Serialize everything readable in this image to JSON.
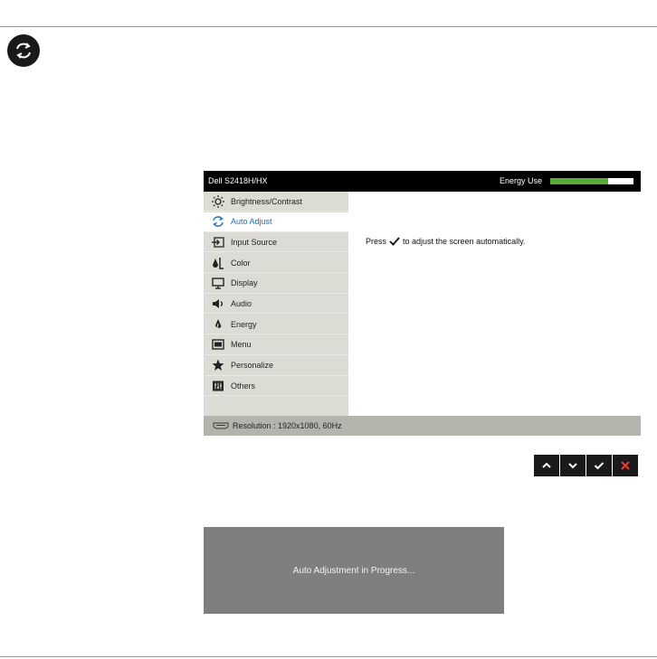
{
  "section_icon": "auto-adjust-icon",
  "osd": {
    "model": "Dell S2418H/HX",
    "energy_label": "Energy Use",
    "energy_level": 0.7,
    "colors": {
      "energy": "#5aaa3a",
      "selected_text": "#1a6fb5",
      "menu_bg": "#dcdcd4",
      "footer_bg": "#b4b4ac"
    },
    "menu": [
      {
        "label": "Brightness/Contrast",
        "icon": "brightness-icon"
      },
      {
        "label": "Auto Adjust",
        "icon": "auto-adjust-icon",
        "selected": true
      },
      {
        "label": "Input Source",
        "icon": "input-source-icon"
      },
      {
        "label": "Color",
        "icon": "color-icon"
      },
      {
        "label": "Display",
        "icon": "display-icon"
      },
      {
        "label": "Audio",
        "icon": "audio-icon"
      },
      {
        "label": "Energy",
        "icon": "energy-icon"
      },
      {
        "label": "Menu",
        "icon": "menu-icon"
      },
      {
        "label": "Personalize",
        "icon": "star-icon"
      },
      {
        "label": "Others",
        "icon": "others-icon"
      }
    ],
    "content": {
      "press": "Press",
      "after": "to adjust the screen automatically."
    },
    "footer": "Resolution : 1920x1080, 60Hz"
  },
  "buttons": [
    {
      "name": "up-button",
      "icon": "chevron-up-icon"
    },
    {
      "name": "down-button",
      "icon": "chevron-down-icon"
    },
    {
      "name": "ok-button",
      "icon": "check-icon"
    },
    {
      "name": "exit-button",
      "icon": "close-icon"
    }
  ],
  "dialog": {
    "message": "Auto Adjustment in Progress..."
  }
}
